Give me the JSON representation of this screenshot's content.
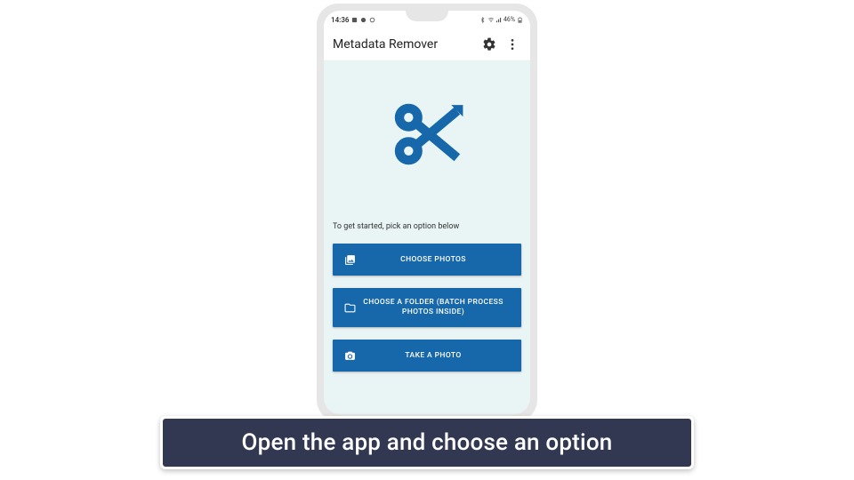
{
  "status": {
    "time": "14:36",
    "battery": "46%"
  },
  "appbar": {
    "title": "Metadata Remover"
  },
  "hint": "To get started, pick an option below",
  "buttons": {
    "choose_photos": "CHOOSE PHOTOS",
    "choose_folder": "CHOOSE A FOLDER (BATCH PROCESS PHOTOS INSIDE)",
    "take_photo": "TAKE A PHOTO"
  },
  "caption": "Open the app and choose an option",
  "colors": {
    "accent": "#1768aa",
    "screen_bg": "#e9f4f5",
    "banner_bg": "#333852"
  }
}
